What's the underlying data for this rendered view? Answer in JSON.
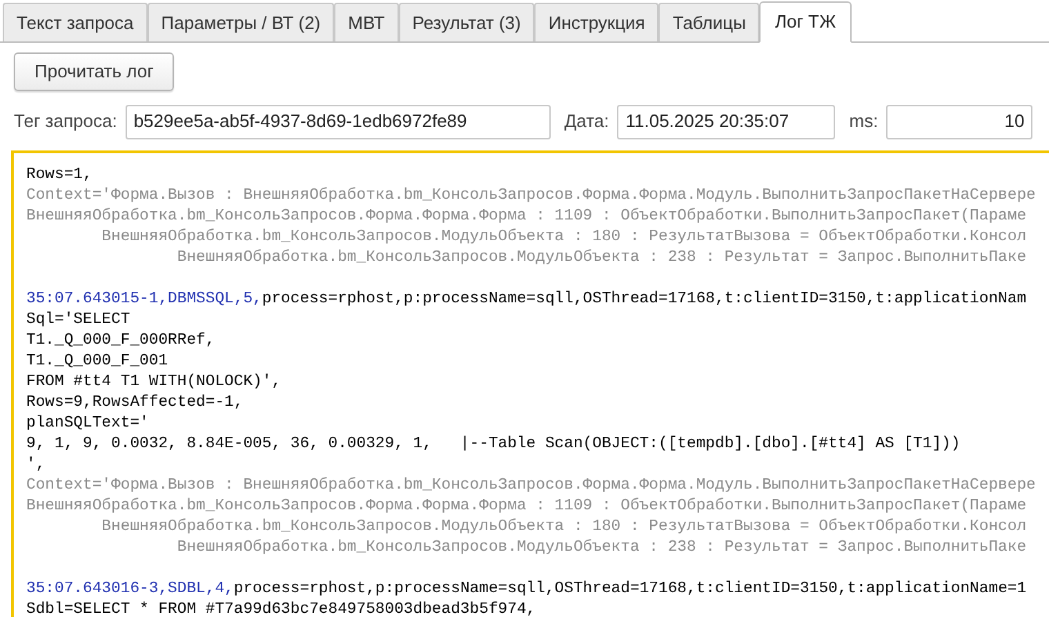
{
  "tabs": [
    {
      "label": "Текст запроса",
      "selected": false
    },
    {
      "label": "Параметры / ВТ (2)",
      "selected": false
    },
    {
      "label": "МВТ",
      "selected": false
    },
    {
      "label": "Результат (3)",
      "selected": false
    },
    {
      "label": "Инструкция",
      "selected": false
    },
    {
      "label": "Таблицы",
      "selected": false
    },
    {
      "label": "Лог ТЖ",
      "selected": true
    }
  ],
  "read_button": "Прочитать лог",
  "fields": [
    {
      "label": "Тег запроса:",
      "value": "b529ee5a-ab5f-4937-8d69-1edb6972fe89",
      "kind": "text"
    },
    {
      "label": "Дата:",
      "value": "11.05.2025 20:35:07",
      "kind": "text"
    },
    {
      "label": "ms:",
      "value": "10",
      "kind": "number"
    }
  ],
  "log": [
    {
      "kind": "plain",
      "text": "Rows=1,"
    },
    {
      "kind": "context",
      "text": "Context='Форма.Вызов : ВнешняяОбработка.bm_КонсольЗапросов.Форма.Форма.Модуль.ВыполнитьЗапросПакетНаСервере"
    },
    {
      "kind": "context",
      "text": "ВнешняяОбработка.bm_КонсольЗапросов.Форма.Форма.Форма : 1109 : ОбъектОбработки.ВыполнитьЗапросПакет(Параме"
    },
    {
      "kind": "context",
      "text": "        ВнешняяОбработка.bm_КонсольЗапросов.МодульОбъекта : 180 : РезультатВызова = ОбъектОбработки.Консол"
    },
    {
      "kind": "context",
      "text": "                ВнешняяОбработка.bm_КонсольЗапросов.МодульОбъекта : 238 : Результат = Запрос.ВыполнитьПаке"
    },
    {
      "kind": "blank"
    },
    {
      "kind": "event",
      "event": "35:07.643015-1,DBMSSQL,5,",
      "text": "process=rphost,p:processName=sqll,OSThread=17168,t:clientID=3150,t:applicationNam"
    },
    {
      "kind": "plain",
      "text": "Sql='SELECT"
    },
    {
      "kind": "plain",
      "text": "T1._Q_000_F_000RRef,"
    },
    {
      "kind": "plain",
      "text": "T1._Q_000_F_001"
    },
    {
      "kind": "plain",
      "text": "FROM #tt4 T1 WITH(NOLOCK)',"
    },
    {
      "kind": "plain",
      "text": "Rows=9,RowsAffected=-1,"
    },
    {
      "kind": "plain",
      "text": "planSQLText='"
    },
    {
      "kind": "plain",
      "text": "9, 1, 9, 0.0032, 8.84E-005, 36, 0.00329, 1,   |--Table Scan(OBJECT:([tempdb].[dbo].[#tt4] AS [T1]))"
    },
    {
      "kind": "plain",
      "text": "',"
    },
    {
      "kind": "context",
      "text": "Context='Форма.Вызов : ВнешняяОбработка.bm_КонсольЗапросов.Форма.Форма.Модуль.ВыполнитьЗапросПакетНаСервере"
    },
    {
      "kind": "context",
      "text": "ВнешняяОбработка.bm_КонсольЗапросов.Форма.Форма.Форма : 1109 : ОбъектОбработки.ВыполнитьЗапросПакет(Параме"
    },
    {
      "kind": "context",
      "text": "        ВнешняяОбработка.bm_КонсольЗапросов.МодульОбъекта : 180 : РезультатВызова = ОбъектОбработки.Консол"
    },
    {
      "kind": "context",
      "text": "                ВнешняяОбработка.bm_КонсольЗапросов.МодульОбъекта : 238 : Результат = Запрос.ВыполнитьПаке"
    },
    {
      "kind": "blank"
    },
    {
      "kind": "event",
      "event": "35:07.643016-3,SDBL,4,",
      "text": "process=rphost,p:processName=sqll,OSThread=17168,t:clientID=3150,t:applicationName=1"
    },
    {
      "kind": "plain",
      "text": "Sdbl=SELECT * FROM #T7a99d63bc7e849758003dbead3b5f974,"
    }
  ]
}
